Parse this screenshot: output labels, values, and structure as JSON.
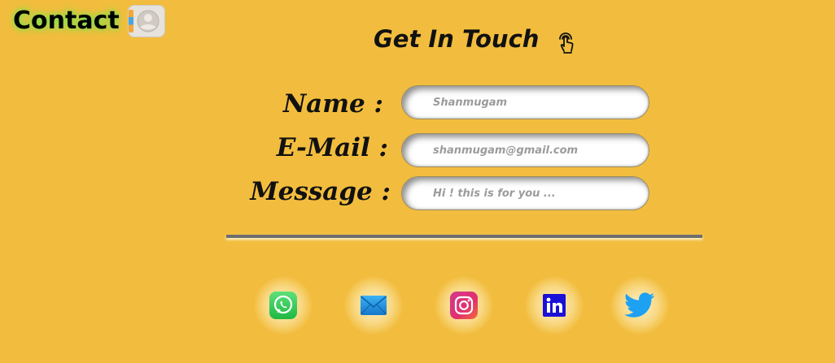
{
  "header": {
    "brand_title": "Contact",
    "brand_icon": "contact-book-icon"
  },
  "main": {
    "heading": "Get In Touch",
    "heading_icon": "touch-pointer-icon"
  },
  "form": {
    "fields": [
      {
        "label": "Name :",
        "placeholder": "Shanmugam",
        "value": ""
      },
      {
        "label": "E-Mail :",
        "placeholder": "shanmugam@gmail.com",
        "value": ""
      },
      {
        "label": "Message :",
        "placeholder": "Hi ! this is for you ...",
        "value": ""
      }
    ]
  },
  "social": [
    {
      "name": "whatsapp",
      "icon": "whatsapp-icon",
      "color": "#25d366"
    },
    {
      "name": "email",
      "icon": "mail-icon",
      "color": "#2196f3"
    },
    {
      "name": "instagram",
      "icon": "instagram-icon",
      "color": "#e1306c"
    },
    {
      "name": "linkedin",
      "icon": "linkedin-icon",
      "color": "#1a10d8"
    },
    {
      "name": "twitter",
      "icon": "twitter-icon",
      "color": "#1da1f2"
    }
  ],
  "colors": {
    "background": "#f2bd3e",
    "brand_glow": "#7ee34a",
    "divider": "#6d6d6d"
  }
}
